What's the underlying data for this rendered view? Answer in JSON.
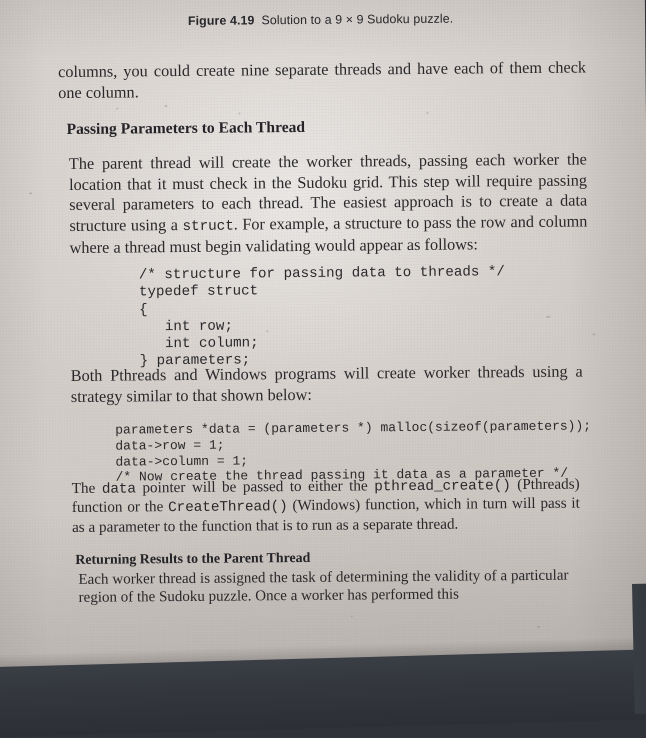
{
  "figure": {
    "label": "Figure 4.19",
    "text": "Solution to a 9 × 9 Sudoku puzzle."
  },
  "body": {
    "para_columns": "columns, you could create nine separate threads and have each of them check one column.",
    "heading_passing": "Passing Parameters to Each Thread",
    "para_parent_a": "The parent thread will create the worker threads, passing each worker the location that it must check in the Sudoku grid. This step will require passing several parameters to each thread. The easiest approach is to create a data structure using a ",
    "para_parent_code": "struct",
    "para_parent_b": ". For example, a structure to pass the row and column where a thread must begin validating would appear as follows:",
    "code_struct": "/* structure for passing data to threads */\ntypedef struct\n{\n   int row;\n   int column;\n} parameters;",
    "para_both": "Both Pthreads and Windows programs will create worker threads using a strategy similar to that shown below:",
    "code_create": "parameters *data = (parameters *) malloc(sizeof(parameters));\ndata->row = 1;\ndata->column = 1;\n/* Now create the thread passing it data as a parameter */",
    "para_datap_a": "The ",
    "para_datap_code1": "data",
    "para_datap_b": " pointer will be passed to either the ",
    "para_datap_code2": "pthread_create()",
    "para_datap_c": " (Pthreads) function or the ",
    "para_datap_code3": "CreateThread()",
    "para_datap_d": " (Windows) function, which in turn will pass it as a parameter to the function that is to run as a separate thread.",
    "heading_returning": "Returning Results to the Parent Thread",
    "para_each": "Each worker thread is assigned the task of determining the validity of a particular region of the Sudoku puzzle. Once a worker has performed this"
  }
}
